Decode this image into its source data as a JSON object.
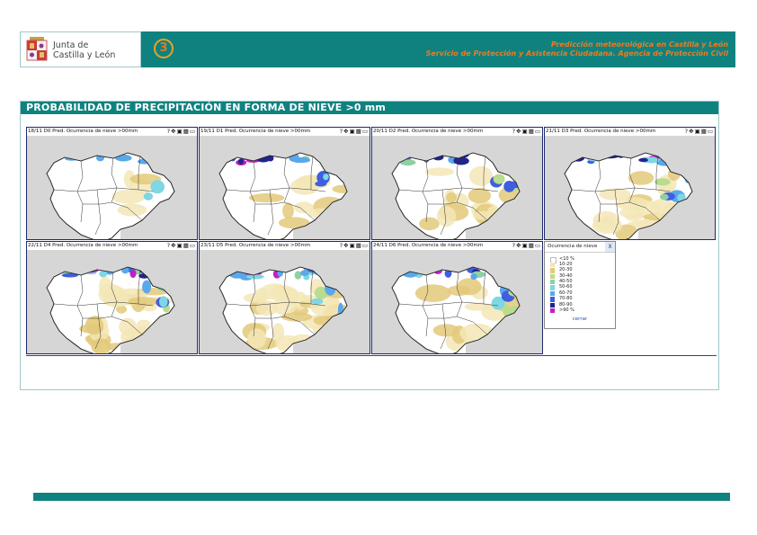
{
  "header": {
    "logo_line1": "Junta de",
    "logo_line2": "Castilla y León",
    "page_number": "3",
    "title_line1": "Predicción meteorológica en Castilla y León",
    "title_line2": "Servicio de Protección y Asistencia Ciudadana. Agencia de Protección Civil"
  },
  "section": {
    "title": "PROBABILIDAD DE PRECIPITACIÓN EN FORMA DE NIEVE >0 mm"
  },
  "maps": [
    {
      "label": "18/11 D0 Pred. Ocurrencia de nieve >00mm",
      "level": 0
    },
    {
      "label": "19/11 D1 Pred. Ocurrencia de nieve >00mm",
      "level": 1
    },
    {
      "label": "20/11 D2 Pred. Ocurrencia de nieve >00mm",
      "level": 3
    },
    {
      "label": "21/11 D3 Pred. Ocurrencia de nieve >00mm",
      "level": 2
    },
    {
      "label": "22/11 D4 Pred. Ocurrencia de nieve >00mm",
      "level": 4
    },
    {
      "label": "23/11 D5 Pred. Ocurrencia de nieve >00mm",
      "level": 4
    },
    {
      "label": "24/11 D6 Pred. Ocurrencia de nieve >00mm",
      "level": 3
    }
  ],
  "map_tools": "?✥▣▦▭",
  "legend": {
    "title": "Ocurrencia de nieve",
    "close_x": "X",
    "close_label": "cerrar",
    "items": [
      {
        "label": "<10  %",
        "color": "#ffffff"
      },
      {
        "label": "10-20",
        "color": "#f3e6b6"
      },
      {
        "label": "20-30",
        "color": "#e3c97a"
      },
      {
        "label": "30-40",
        "color": "#b9dc8e"
      },
      {
        "label": "40-50",
        "color": "#8fd0a4"
      },
      {
        "label": "50-60",
        "color": "#7fd6e4"
      },
      {
        "label": "60-70",
        "color": "#5aa8ea"
      },
      {
        "label": "70-80",
        "color": "#3f5fe0"
      },
      {
        "label": "80-90",
        "color": "#23238f"
      },
      {
        "label": ">90  %",
        "color": "#c21fc2"
      }
    ]
  }
}
